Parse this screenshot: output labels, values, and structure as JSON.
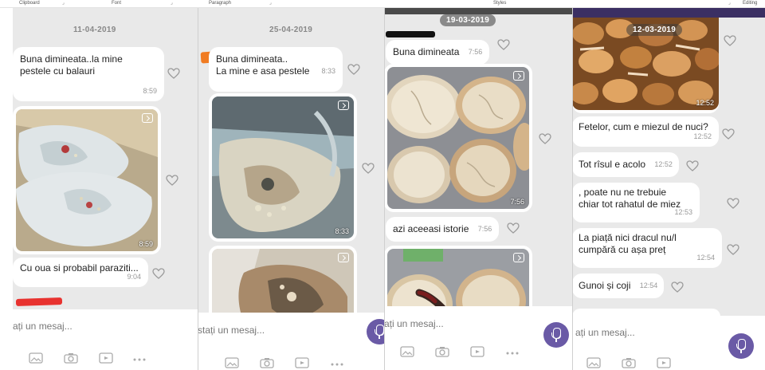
{
  "ribbon": {
    "groups": [
      "Clipboard",
      "Font",
      "Paragraph",
      "Styles",
      "Editing"
    ]
  },
  "panel1": {
    "date": "11-04-2019",
    "messages": [
      {
        "text": "Buna dimineata..la mine\npestele cu balauri",
        "time": "8:59"
      },
      {
        "photo_time": "8:59"
      },
      {
        "text": "Cu oua si probabil paraziti...",
        "time": "9:04"
      }
    ],
    "composer_placeholder": "ați un mesaj..."
  },
  "panel2": {
    "date": "25-04-2019",
    "messages": [
      {
        "text": "Buna dimineata..\nLa mine e asa pestele",
        "time": "8:33"
      },
      {
        "photo_time": "8:33"
      }
    ],
    "composer_placeholder": "stați un mesaj..."
  },
  "panel3": {
    "date": "19-03-2019",
    "messages": [
      {
        "text": "Buna dimineata",
        "time": "7:56"
      },
      {
        "photo_time": "7:56"
      },
      {
        "text": "azi aceeasi istorie",
        "time": "7:56"
      }
    ],
    "composer_placeholder": "ați un mesaj..."
  },
  "panel4": {
    "date": "12-03-2019",
    "messages": [
      {
        "photo_time": "12:52"
      },
      {
        "text": "Fetelor, cum e miezul de nuci?",
        "time": "12:52"
      },
      {
        "text": "Tot rîsul e acolo",
        "time": "12:52"
      },
      {
        "text": ", poate nu ne trebuie\nchiar tot rahatul de miez",
        "time": "12:53"
      },
      {
        "text": "La piață nici dracul nu/l\ncumpără cu așa preț",
        "time": "12:54"
      },
      {
        "text": "Gunoi și coji",
        "time": "12:54"
      }
    ],
    "composer_placeholder": "ați un mesaj..."
  },
  "colors": {
    "chat_background": "#e9e9e9",
    "bubble": "#ffffff",
    "accent_purple": "#6a5aa6",
    "header_purple": "#3b2f63",
    "redaction_red": "#e8322f",
    "redaction_orange": "#f07b22",
    "redaction_black": "#111111"
  },
  "icons": [
    "heart-icon",
    "forward-icon",
    "gallery-icon",
    "camera-icon",
    "gif-icon",
    "more-icon",
    "microphone-icon"
  ]
}
